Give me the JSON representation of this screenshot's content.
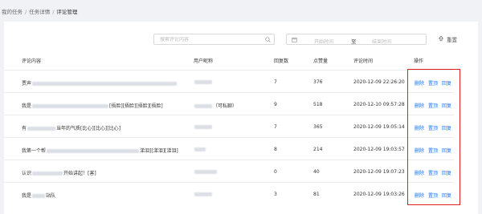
{
  "breadcrumb": {
    "items": [
      "我的任务",
      "任务详情"
    ],
    "current": "评论管理",
    "separator": "/"
  },
  "search": {
    "placeholder": "搜索评论内容"
  },
  "daterange": {
    "start_placeholder": "开始时间",
    "to": "至",
    "end_placeholder": "结束时间"
  },
  "reset": {
    "label": "重置"
  },
  "table": {
    "headers": {
      "content": "评论内容",
      "nickname": "用户昵称",
      "replies": "回复数",
      "likes": "点赞量",
      "time": "评论时间",
      "actions": "操作"
    },
    "rows": [
      {
        "content_pre": "贾声",
        "content_post": "",
        "nickname_post": "",
        "replies": "7",
        "likes": "376",
        "time": "2020-12-09 22:26:20"
      },
      {
        "content_pre": "我是",
        "content_post": "[捂脸][捂脸][捂脸][捂脸]",
        "nickname_post": "（可私聊）",
        "replies": "9",
        "likes": "518",
        "time": "2020-12-10 09:57:28"
      },
      {
        "content_pre": "有",
        "content_post": "当年的气质[比心][比心][比心]",
        "nickname_post": "",
        "replies": "7",
        "likes": "365",
        "time": "2020-12-09 19:05:14"
      },
      {
        "content_pre": "我第一个帮",
        "content_post": "涕泪][涕泪][涕泪]",
        "nickname_post": "",
        "replies": "8",
        "likes": "214",
        "time": "2020-12-09 19:03:57"
      },
      {
        "content_pre": "认识",
        "content_post": "开始讲起！[害]",
        "nickname_post": "",
        "replies": "0",
        "likes": "40",
        "time": "2020-12-09 19:07:23"
      },
      {
        "content_pre": "我是",
        "content_post": "站队",
        "nickname_post": "",
        "replies": "3",
        "likes": "81",
        "time": "2020-12-09 19:03:26"
      }
    ],
    "action_labels": {
      "delete": "删除",
      "pin": "置顶",
      "reply": "回复"
    }
  },
  "colors": {
    "link": "#1677ff",
    "highlight": "#e02020"
  },
  "icons": {
    "search": "search-icon",
    "calendar": "calendar-icon",
    "reset": "reset-icon"
  }
}
